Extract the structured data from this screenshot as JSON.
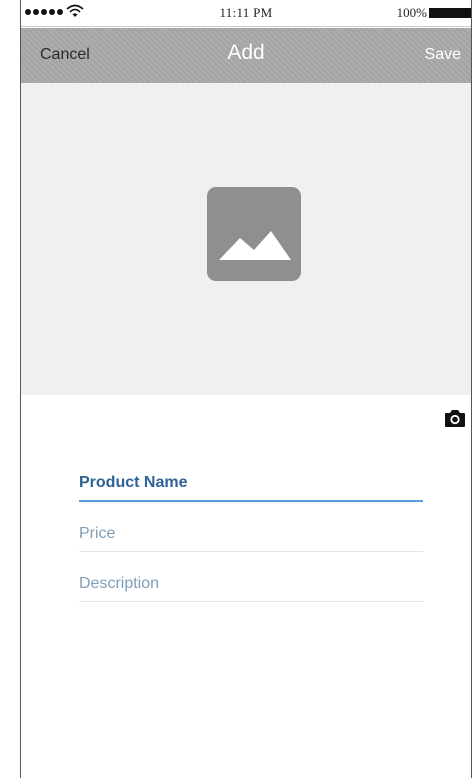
{
  "status_bar": {
    "time": "11:11 PM",
    "battery": "100%",
    "signal_icon": "signal-dots-icon",
    "wifi_icon": "wifi-icon",
    "battery_icon": "battery-icon"
  },
  "nav": {
    "cancel_label": "Cancel",
    "title": "Add",
    "save_label": "Save"
  },
  "media": {
    "placeholder_icon": "image-placeholder-icon",
    "camera_icon": "camera-icon"
  },
  "form": {
    "product_name_placeholder": "Product Name",
    "price_placeholder": "Price",
    "description_placeholder": "Description"
  },
  "colors": {
    "nav_bg": "#aaaaaa",
    "image_bg": "#f0f0f0",
    "accent": "#5b9bd5",
    "active_label": "#2f6296",
    "placeholder_text": "#7f9eb8"
  }
}
